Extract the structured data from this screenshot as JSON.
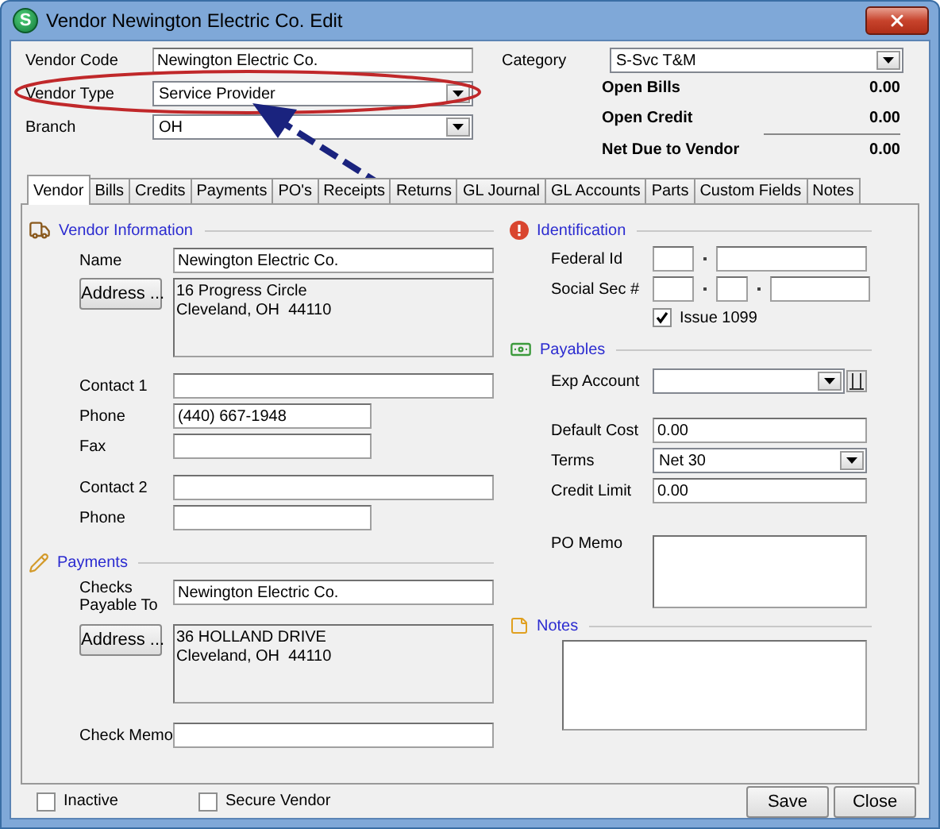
{
  "window": {
    "title": "Vendor Newington Electric Co. Edit",
    "app_icon_letter": "S"
  },
  "header": {
    "fields": [
      {
        "label": "Vendor Code",
        "value": "Newington Electric Co.",
        "kind": "text"
      },
      {
        "label": "Vendor Type",
        "value": "Service Provider",
        "kind": "select"
      },
      {
        "label": "Branch",
        "value": "OH",
        "kind": "select"
      }
    ],
    "category": {
      "label": "Category",
      "value": "S-Svc T&M"
    },
    "totals": [
      {
        "label": "Open Bills",
        "value": "0.00"
      },
      {
        "label": "Open Credit",
        "value": "0.00"
      },
      {
        "label": "Net Due to Vendor",
        "value": "0.00"
      }
    ]
  },
  "tabs": [
    {
      "label": "Vendor",
      "selected": true
    },
    {
      "label": "Bills",
      "selected": false
    },
    {
      "label": "Credits",
      "selected": false
    },
    {
      "label": "Payments",
      "selected": false
    },
    {
      "label": "PO's",
      "selected": false
    },
    {
      "label": "Receipts",
      "selected": false
    },
    {
      "label": "Returns",
      "selected": false
    },
    {
      "label": "GL Journal",
      "selected": false
    },
    {
      "label": "GL Accounts",
      "selected": false
    },
    {
      "label": "Parts",
      "selected": false
    },
    {
      "label": "Custom Fields",
      "selected": false
    },
    {
      "label": "Notes",
      "selected": false
    }
  ],
  "vendor_information": {
    "title": "Vendor Information",
    "name": {
      "label": "Name",
      "value": "Newington Electric Co."
    },
    "address_button": "Address ...",
    "address": [
      "16 Progress Circle",
      "Cleveland, OH  44110"
    ],
    "contacts": [
      {
        "label": "Contact 1",
        "kind": "wide"
      },
      {
        "label": "Phone",
        "value": "(440) 667-1948",
        "kind": "narrow"
      },
      {
        "label": "Fax",
        "kind": "narrow"
      },
      {
        "label": "Contact 2",
        "kind": "wide"
      },
      {
        "label": "Phone",
        "kind": "narrow"
      }
    ]
  },
  "payments": {
    "title": "Payments",
    "checks_payable_to": {
      "label": "Checks Payable To",
      "value": "Newington Electric Co."
    },
    "address_button": "Address ...",
    "address": [
      "36 HOLLAND DRIVE",
      "Cleveland, OH  44110"
    ],
    "check_memo": {
      "label": "Check Memo"
    }
  },
  "identification": {
    "title": "Identification",
    "fields": [
      {
        "label": "Federal Id",
        "kind": "ein"
      },
      {
        "label": "Social Sec #",
        "kind": "ssn"
      }
    ],
    "issue_1099": {
      "label": "Issue 1099",
      "checked": true
    }
  },
  "payables": {
    "title": "Payables",
    "exp_account": {
      "label": "Exp Account"
    },
    "default_cost": {
      "label": "Default Cost",
      "value": "0.00"
    },
    "terms": {
      "label": "Terms",
      "value": "Net 30"
    },
    "credit_limit": {
      "label": "Credit Limit",
      "value": "0.00"
    },
    "po_memo": {
      "label": "PO Memo"
    }
  },
  "notes": {
    "title": "Notes"
  },
  "footer": {
    "checkboxes": [
      {
        "label": "Inactive",
        "checked": false
      },
      {
        "label": "Secure Vendor",
        "checked": false
      }
    ],
    "buttons": [
      "Save",
      "Close"
    ]
  }
}
